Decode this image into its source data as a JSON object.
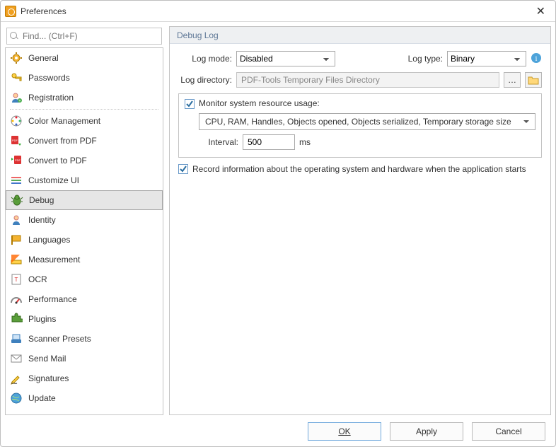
{
  "window": {
    "title": "Preferences"
  },
  "search": {
    "placeholder": "Find... (Ctrl+F)"
  },
  "sidebar": {
    "items": [
      {
        "label": "General",
        "icon": "gear-icon"
      },
      {
        "label": "Passwords",
        "icon": "key-icon"
      },
      {
        "label": "Registration",
        "icon": "person-add-icon"
      },
      {
        "label": "Color Management",
        "icon": "palette-icon"
      },
      {
        "label": "Convert from PDF",
        "icon": "pdf-from-icon"
      },
      {
        "label": "Convert to PDF",
        "icon": "pdf-to-icon"
      },
      {
        "label": "Customize UI",
        "icon": "slider-icon"
      },
      {
        "label": "Debug",
        "icon": "bug-icon"
      },
      {
        "label": "Identity",
        "icon": "person-icon"
      },
      {
        "label": "Languages",
        "icon": "flag-icon"
      },
      {
        "label": "Measurement",
        "icon": "ruler-icon"
      },
      {
        "label": "OCR",
        "icon": "text-icon"
      },
      {
        "label": "Performance",
        "icon": "gauge-icon"
      },
      {
        "label": "Plugins",
        "icon": "puzzle-icon"
      },
      {
        "label": "Scanner Presets",
        "icon": "scanner-icon"
      },
      {
        "label": "Send Mail",
        "icon": "mail-icon"
      },
      {
        "label": "Signatures",
        "icon": "pen-icon"
      },
      {
        "label": "Update",
        "icon": "globe-icon"
      }
    ],
    "selected_index": 7
  },
  "panel": {
    "title": "Debug Log",
    "log_mode_label": "Log mode:",
    "log_mode_value": "Disabled",
    "log_type_label": "Log type:",
    "log_type_value": "Binary",
    "log_directory_label": "Log directory:",
    "log_directory_value": "PDF-Tools Temporary Files Directory",
    "monitor_label": "Monitor system resource usage:",
    "monitor_options": "CPU, RAM, Handles, Objects opened, Objects serialized, Temporary storage size",
    "interval_label": "Interval:",
    "interval_value": "500",
    "interval_unit": "ms",
    "record_info_label": "Record information about the operating system and hardware when the application starts"
  },
  "footer": {
    "ok": "OK",
    "apply": "Apply",
    "cancel": "Cancel"
  }
}
